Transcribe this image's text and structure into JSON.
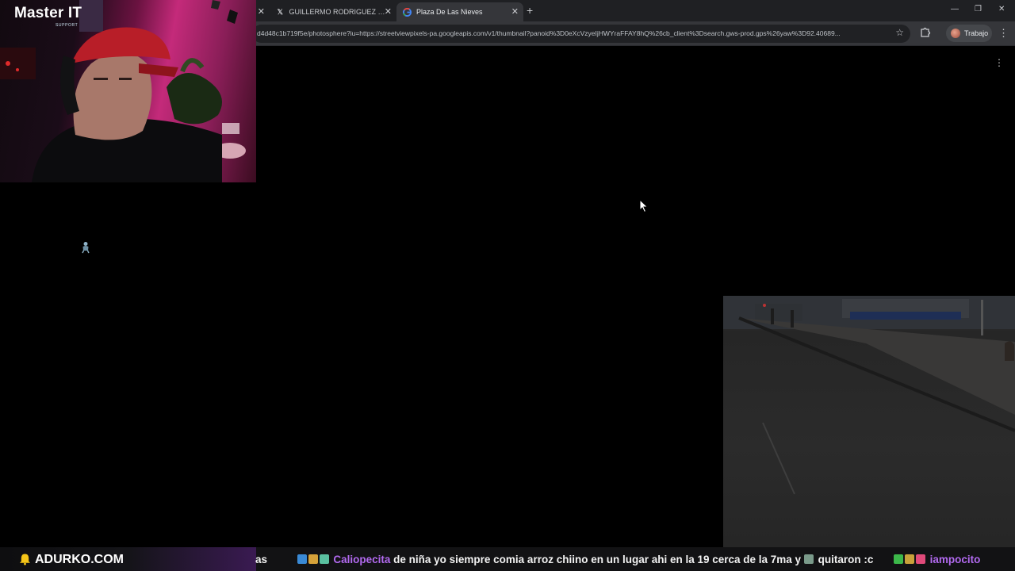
{
  "browser": {
    "tabs": [
      {
        "label": "GUILLERMO RODRIGUEZ M (@",
        "favicon": "x-logo-icon",
        "active": false
      },
      {
        "label": "Plaza De Las Nieves",
        "favicon": "google-logo-icon",
        "active": true
      }
    ],
    "new_tab_label": "+",
    "url": "d4d48c1b719f5e/photosphere?iu=https://streetviewpixels-pa.googleapis.com/v1/thumbnail?panoid%3D0eXcVzyeIjHWYraFFAY8hQ%26cb_client%3Dsearch.gws-prod.gps%26yaw%3D92.40689...",
    "profile_label": "Trabajo",
    "window_controls": [
      "minimize-icon",
      "restore-icon",
      "close-icon"
    ]
  },
  "overlay": {
    "logo": "Master IT",
    "logo_sub": "SUPPORT"
  },
  "ticker": {
    "brand": "ADURKO.COM",
    "cut_text": "as",
    "user1": "Caliopecita",
    "message1": "de niña yo siempre comia arroz chiino en un lugar ahi en la 19 cerca de la 7ma y",
    "message1_end": "quitaron :c",
    "user2": "iampocito"
  },
  "colors": {
    "tab_strip": "#1f2023",
    "toolbar": "#35363a",
    "omnibox": "#202124",
    "ticker_username": "#b26af0",
    "logo_accent": "#29b6f6"
  }
}
